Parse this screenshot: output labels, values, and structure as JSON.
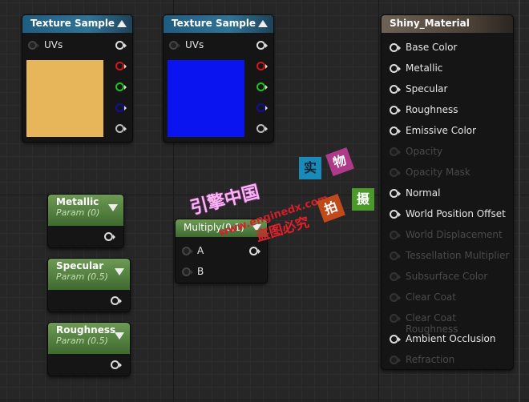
{
  "texture_nodes": [
    {
      "title": "Texture Sample",
      "input": "UVs",
      "swatch_color": "#e8b65a"
    },
    {
      "title": "Texture Sample",
      "input": "UVs",
      "swatch_color": "#0a14f0"
    }
  ],
  "param_nodes": [
    {
      "title": "Metallic",
      "subtitle": "Param (0)"
    },
    {
      "title": "Specular",
      "subtitle": "Param (0.5)"
    },
    {
      "title": "Roughness",
      "subtitle": "Param (0.5)"
    }
  ],
  "multiply": {
    "title": "Multiply(0,1)",
    "inputs": [
      "A",
      "B"
    ]
  },
  "material": {
    "title": "Shiny_Material",
    "inputs": [
      {
        "label": "Base Color",
        "enabled": true
      },
      {
        "label": "Metallic",
        "enabled": true
      },
      {
        "label": "Specular",
        "enabled": true
      },
      {
        "label": "Roughness",
        "enabled": true
      },
      {
        "label": "Emissive Color",
        "enabled": true
      },
      {
        "label": "Opacity",
        "enabled": false
      },
      {
        "label": "Opacity Mask",
        "enabled": false
      },
      {
        "label": "Normal",
        "enabled": true
      },
      {
        "label": "World Position Offset",
        "enabled": true
      },
      {
        "label": "World Displacement",
        "enabled": false
      },
      {
        "label": "Tessellation Multiplier",
        "enabled": false
      },
      {
        "label": "Subsurface Color",
        "enabled": false
      },
      {
        "label": "Clear Coat",
        "enabled": false
      },
      {
        "label": "Clear Coat Roughness",
        "enabled": false
      },
      {
        "label": "Ambient Occlusion",
        "enabled": true
      },
      {
        "label": "Refraction",
        "enabled": false
      }
    ]
  },
  "watermark": {
    "brand": "引擎中国",
    "url": "www.enginedx.com",
    "notice": "盗图必究",
    "tags": [
      "实",
      "物",
      "拍",
      "摄"
    ]
  }
}
